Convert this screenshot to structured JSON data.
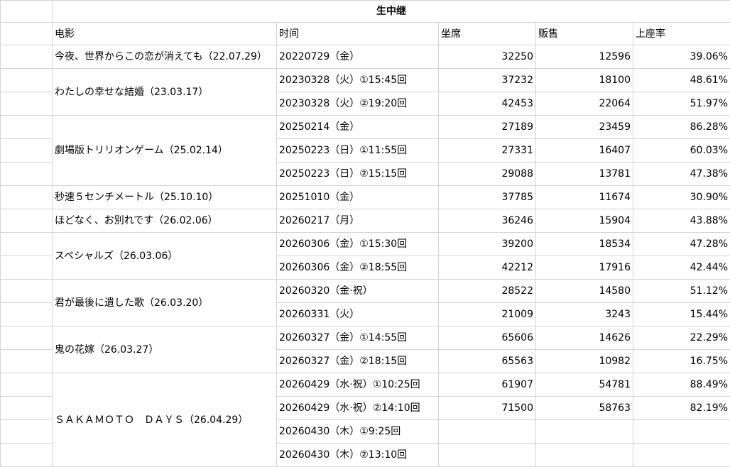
{
  "title": "生中继",
  "headers": {
    "movie": "电影",
    "time": "时间",
    "seats": "坐席",
    "sales": "贩售",
    "rate": "上座率"
  },
  "movies": [
    {
      "name": "今夜、世界からこの恋が消えても（22.07.29）",
      "rows": 1
    },
    {
      "name": "わたしの幸せな結婚（23.03.17）",
      "rows": 2
    },
    {
      "name": "劇場版トリリオンゲーム（25.02.14）",
      "rows": 3
    },
    {
      "name": "秒速５センチメートル（25.10.10）",
      "rows": 1
    },
    {
      "name": "ほどなく、お別れです（26.02.06）",
      "rows": 1
    },
    {
      "name": "スペシャルズ（26.03.06）",
      "rows": 2
    },
    {
      "name": "君が最後に遺した歌（26.03.20）",
      "rows": 2
    },
    {
      "name": "鬼の花嫁（26.03.27）",
      "rows": 2
    },
    {
      "name": "ＳＡＫＡＭＯＴＯ　ＤＡＹＳ（26.04.29）",
      "rows": 4
    }
  ],
  "rows": [
    {
      "time": "20220729（金）",
      "seats": "32250",
      "sales": "12596",
      "rate": "39.06%"
    },
    {
      "time": "20230328（火）①15:45回",
      "seats": "37232",
      "sales": "18100",
      "rate": "48.61%"
    },
    {
      "time": "20230328（火）②19:20回",
      "seats": "42453",
      "sales": "22064",
      "rate": "51.97%"
    },
    {
      "time": "20250214（金）",
      "seats": "27189",
      "sales": "23459",
      "rate": "86.28%"
    },
    {
      "time": "20250223（日）①11:55回",
      "seats": "27331",
      "sales": "16407",
      "rate": "60.03%"
    },
    {
      "time": "20250223（日）②15:15回",
      "seats": "29088",
      "sales": "13781",
      "rate": "47.38%"
    },
    {
      "time": "20251010（金）",
      "seats": "37785",
      "sales": "11674",
      "rate": "30.90%"
    },
    {
      "time": "20260217（月）",
      "seats": "36246",
      "sales": "15904",
      "rate": "43.88%"
    },
    {
      "time": "20260306（金）①15:30回",
      "seats": "39200",
      "sales": "18534",
      "rate": "47.28%"
    },
    {
      "time": "20260306（金）②18:55回",
      "seats": "42212",
      "sales": "17916",
      "rate": "42.44%"
    },
    {
      "time": "20260320（金·祝）",
      "seats": "28522",
      "sales": "14580",
      "rate": "51.12%"
    },
    {
      "time": "20260331（火）",
      "seats": "21009",
      "sales": "3243",
      "rate": "15.44%"
    },
    {
      "time": "20260327（金）①14:55回",
      "seats": "65606",
      "sales": "14626",
      "rate": "22.29%"
    },
    {
      "time": "20260327（金）②18:15回",
      "seats": "65563",
      "sales": "10982",
      "rate": "16.75%"
    },
    {
      "time": "20260429（水·祝）①10:25回",
      "seats": "61907",
      "sales": "54781",
      "rate": "88.49%"
    },
    {
      "time": "20260429（水·祝）②14:10回",
      "seats": "71500",
      "sales": "58763",
      "rate": "82.19%"
    },
    {
      "time": "20260430（木）①9:25回",
      "seats": "",
      "sales": "",
      "rate": ""
    },
    {
      "time": "20260430（木）②13:10回",
      "seats": "",
      "sales": "",
      "rate": ""
    }
  ]
}
